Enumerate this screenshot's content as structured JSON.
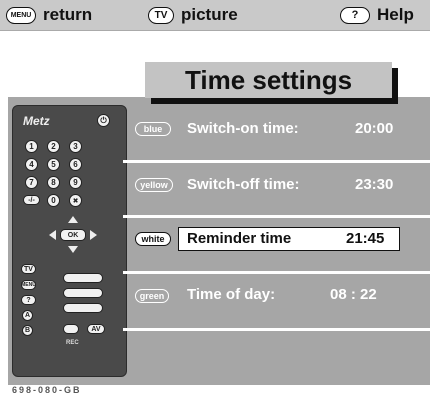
{
  "top_bar": {
    "return": {
      "key": "MENU",
      "label": "return"
    },
    "picture": {
      "key": "TV",
      "label": "picture"
    },
    "help": {
      "key": "?",
      "label": "Help"
    }
  },
  "title": "Time settings",
  "remote": {
    "brand": "Metz",
    "digits": [
      "1",
      "2",
      "3",
      "4",
      "5",
      "6",
      "7",
      "8",
      "9",
      "-/-",
      "0"
    ],
    "ok_label": "OK",
    "tv_label": "TV",
    "menu_label": "MENU",
    "help_label": "?",
    "a_label": "A",
    "b_label": "B",
    "av_label": "AV",
    "rec_label": "REC"
  },
  "rows": [
    {
      "color_key": "blue",
      "label": "Switch-on time:",
      "value": "20:00",
      "selected": false
    },
    {
      "color_key": "yellow",
      "label": "Switch-off time:",
      "value": "23:30",
      "selected": false
    },
    {
      "color_key": "white",
      "label": "Reminder time",
      "value": "21:45",
      "selected": true
    },
    {
      "color_key": "green",
      "label": "Time of day:",
      "value": "08 : 22",
      "selected": false
    }
  ],
  "screen_caption": "698-080-GB"
}
